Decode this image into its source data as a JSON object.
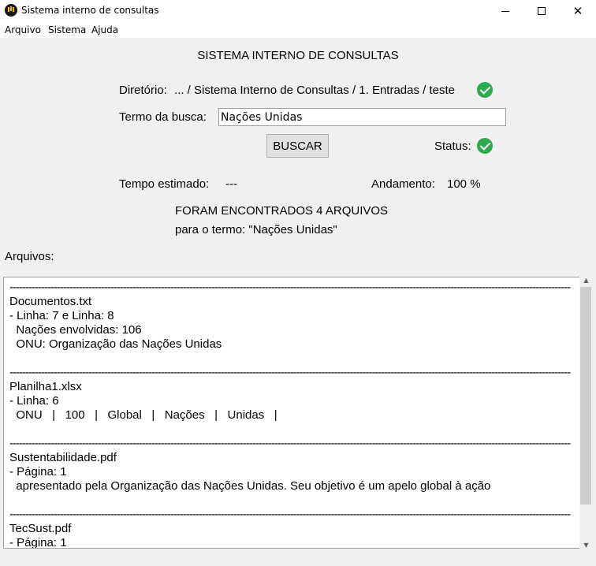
{
  "window": {
    "title": "Sistema interno de consultas",
    "icon": "app-logo-icon"
  },
  "menu": [
    "Arquivo",
    "Sistema",
    "Ajuda"
  ],
  "heading": "SISTEMA INTERNO DE CONSULTAS",
  "directory": {
    "label": "Diretório:",
    "path": "... / Sistema Interno de Consultas / 1. Entradas / teste"
  },
  "search": {
    "label": "Termo da busca:",
    "value": "Nações Unidas"
  },
  "button": {
    "label": "BUSCAR"
  },
  "status": {
    "label": "Status:"
  },
  "time": {
    "label": "Tempo estimado:",
    "value": "---"
  },
  "progress": {
    "label": "Andamento:",
    "value": "100 %"
  },
  "summary": {
    "line1": "FORAM ENCONTRADOS 4 ARQUIVOS",
    "line2": "para o termo: \"Nações Unidas\""
  },
  "files_label": "Arquivos:",
  "results": [
    {
      "filename": "Documentos.txt",
      "lines": [
        "- Linha: 7 e Linha: 8",
        "  Nações envolvidas: 106",
        "  ONU: Organização das Nações Unidas"
      ]
    },
    {
      "filename": "Planilha1.xlsx",
      "lines": [
        "- Linha: 6",
        "  ONU   |   100   |   Global   |   Nações   |   Unidas   |"
      ]
    },
    {
      "filename": "Sustentabilidade.pdf",
      "lines": [
        "- Página: 1",
        "  apresentado pela Organização das Nações Unidas. Seu objetivo é um apelo global à ação"
      ]
    },
    {
      "filename": "TecSust.pdf",
      "lines": [
        "- Página: 1"
      ]
    }
  ],
  "colors": {
    "check": "#2eaa4f",
    "background": "#f0f0f0"
  }
}
